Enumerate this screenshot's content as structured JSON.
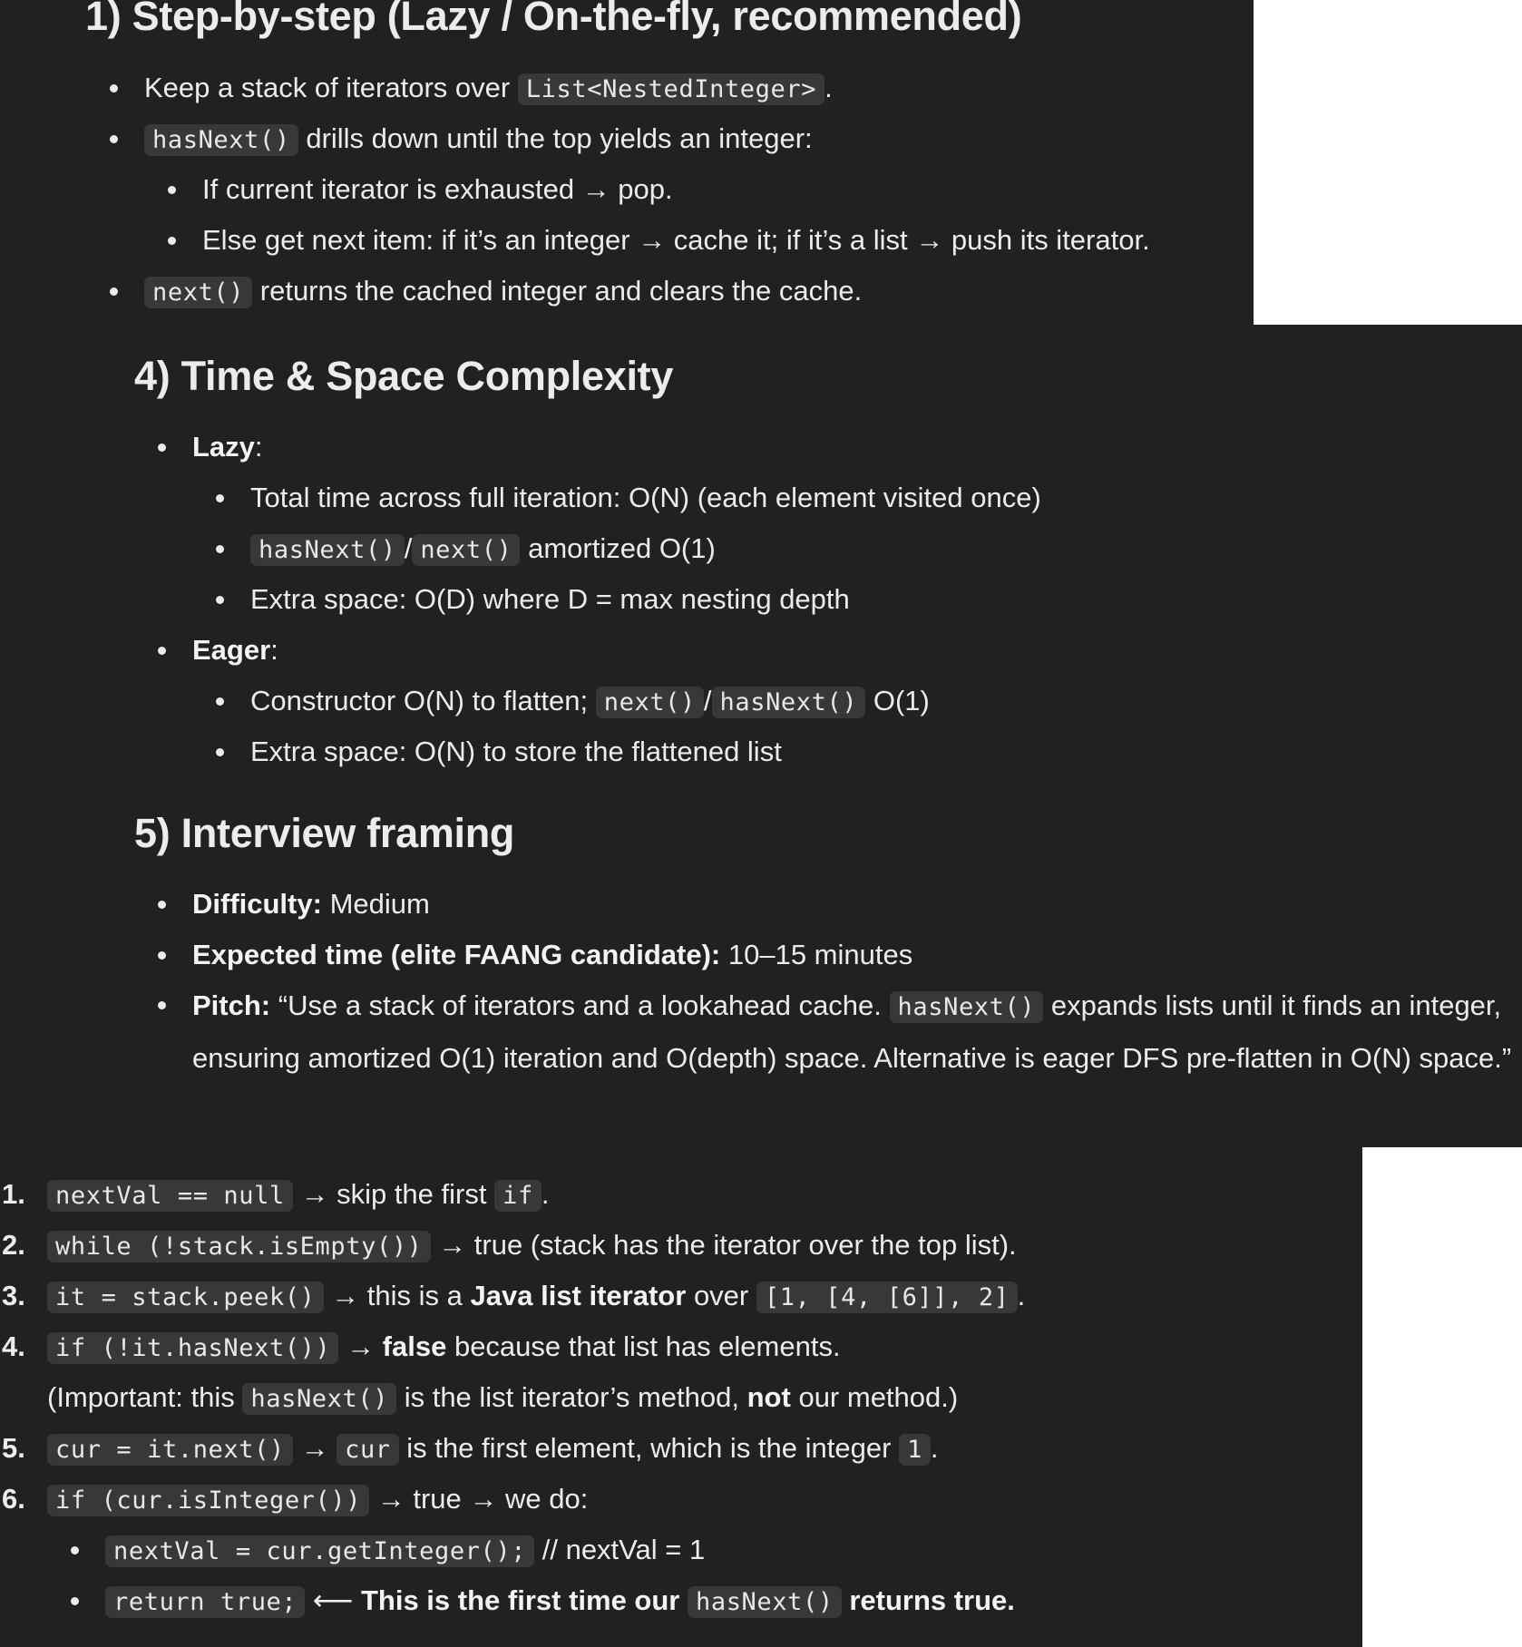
{
  "section1": {
    "heading": "1) Step-by-step (Lazy / On-the-fly, recommended)",
    "b1": {
      "text": "Keep a stack of iterators over",
      "code": "List<NestedInteger>",
      "after": "."
    },
    "b2": {
      "code": "hasNext()",
      "text": "drills down until the top yields an integer:"
    },
    "b2a": "If current iterator is exhausted → pop.",
    "b2b": "Else get next item: if it’s an integer → cache it; if it’s a list → push its iterator.",
    "b3": {
      "code": "next()",
      "text": "returns the cached integer and clears the cache."
    }
  },
  "section4": {
    "heading": "4) Time & Space Complexity",
    "lazy_label": "Lazy",
    "lazy_items": {
      "total": "Total time across full iteration: O(N) (each element visited once)",
      "code1": "hasNext()",
      "slash": "/",
      "code2": "next()",
      "amortized": "amortized O(1)",
      "space": "Extra space: O(D) where D = max nesting depth"
    },
    "eager_label": "Eager",
    "eager_items": {
      "ctor": "Constructor O(N) to flatten;",
      "code1": "next()",
      "slash": "/",
      "code2": "hasNext()",
      "o1": "O(1)",
      "space": "Extra space: O(N) to store the flattened list"
    }
  },
  "section5": {
    "heading": "5) Interview framing",
    "difficulty_label": "Difficulty:",
    "difficulty_value": "Medium",
    "time_label": "Expected time (elite FAANG candidate):",
    "time_value": "10–15 minutes",
    "pitch_label": "Pitch:",
    "pitch_part1": "“Use a stack of iterators and a lookahead cache.",
    "pitch_code": "hasNext()",
    "pitch_part2": "expands lists until it finds an integer, ensuring amortized O(1) iteration and O(depth) space. Alternative is eager DFS pre-flatten in O(N) space.”"
  },
  "trace": {
    "s1": {
      "num": "1.",
      "code": "nextVal == null",
      "text": "→ skip the first",
      "code2": "if",
      "after": "."
    },
    "s2": {
      "num": "2.",
      "code": "while (!stack.isEmpty())",
      "text": "→ true (stack has the iterator over the top list)."
    },
    "s3": {
      "num": "3.",
      "code": "it = stack.peek()",
      "text": "→ this is a",
      "bold": "Java list iterator",
      "text2": "over",
      "code2": "[1, [4, [6]], 2]",
      "after": "."
    },
    "s4": {
      "num": "4.",
      "code": "if (!it.hasNext())",
      "arrow": "→",
      "bold": "false",
      "text": "because that list has elements."
    },
    "note": {
      "text1": "(Important: this",
      "code": "hasNext()",
      "text2": "is the list iterator’s method,",
      "bold": "not",
      "text3": "our method.)"
    },
    "s5": {
      "num": "5.",
      "code": "cur = it.next()",
      "arrow": "→",
      "code2": "cur",
      "text": "is the first element, which is the integer",
      "code3": "1",
      "after": "."
    },
    "s6": {
      "num": "6.",
      "code": "if (cur.isInteger())",
      "text": "→ true → we do:"
    },
    "s6a": {
      "code": "nextVal = cur.getInteger();",
      "text": "// nextVal = 1"
    },
    "s6b": {
      "code": "return true;",
      "arrow": "⟵",
      "bold1": "This is the first time our",
      "code2": "hasNext()",
      "bold2": "returns true."
    }
  }
}
